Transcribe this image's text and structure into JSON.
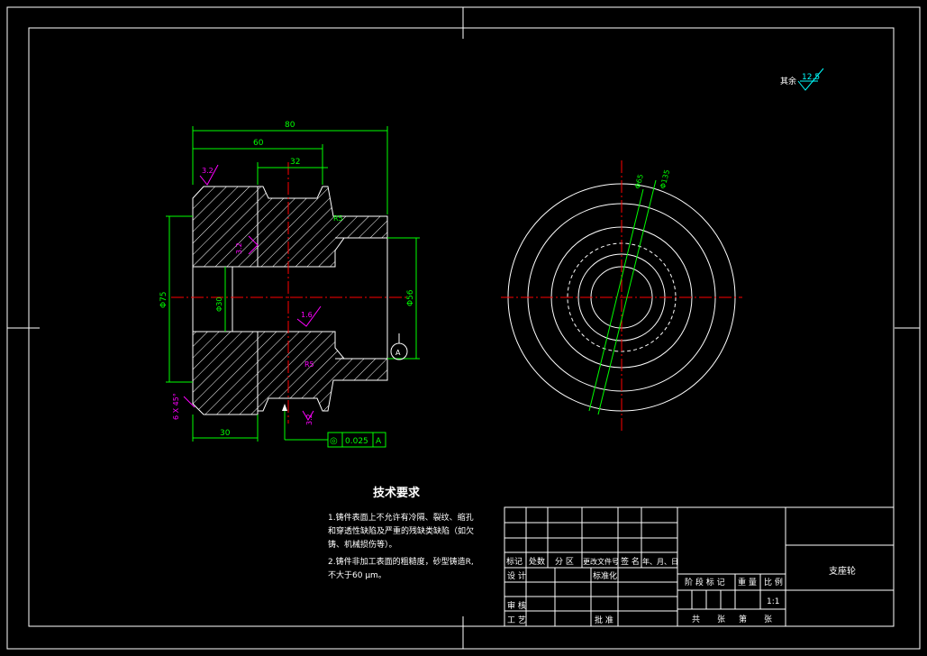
{
  "colors": {
    "background": "#000000",
    "frame": "#ffffff",
    "outline": "#ffffff",
    "dimension": "#00ff00",
    "hatch": "#ffffff",
    "centerline": "#ff0000",
    "annotation": "#ff00ff",
    "tolerance": "#00ff00",
    "roughness": "#00ffff"
  },
  "drawing": {
    "roughness_general": {
      "prefix": "其余",
      "value": "12.5"
    },
    "dimensions": {
      "overall_length": "80",
      "hub_length": "60",
      "flange_width": "32",
      "left_length": "30",
      "outer_diameter": "Φ75",
      "bore_diameter": "Φ56",
      "inner_diameter": "Φ30",
      "chamfer": "6 X 45°",
      "radius_top": "R5",
      "radius_bottom": "R5"
    },
    "annotations": {
      "roughness_a": "3.2",
      "roughness_b": "3.2",
      "roughness_c": "1.6",
      "roughness_d": "3.2",
      "datum": "A"
    },
    "tolerance_frame": {
      "symbol": "◎",
      "value": "0.025",
      "datum": "A"
    },
    "side_view": {
      "dim_a": "Φ65",
      "dim_b": "Φ135"
    }
  },
  "tech_requirements": {
    "title": "技术要求",
    "items": [
      "1.铸件表面上不允许有冷隔、裂纹、缩孔",
      "和穿透性缺陷及严重的残缺类缺陷（如欠",
      "铸、机械损伤等）。",
      "2.铸件非加工表面的粗糙度，砂型铸造R,",
      "不大于60 μm。"
    ]
  },
  "title_block": {
    "part_name": "支座轮",
    "scale": "1:1",
    "headers": {
      "mark": "标记",
      "count": "处数",
      "zone": "分 区",
      "change_doc": "更改文件号",
      "signature": "签 名",
      "date": "年、月、日",
      "design": "设 计",
      "standard": "标准化",
      "stage_mark": "阶 段 标 记",
      "weight": "重 量",
      "ratio": "比 例",
      "review": "审 核",
      "process": "工 艺",
      "approve": "批 准",
      "total": "共",
      "sheets": "张",
      "sheet_no": "第",
      "sheet_unit": "张"
    }
  }
}
